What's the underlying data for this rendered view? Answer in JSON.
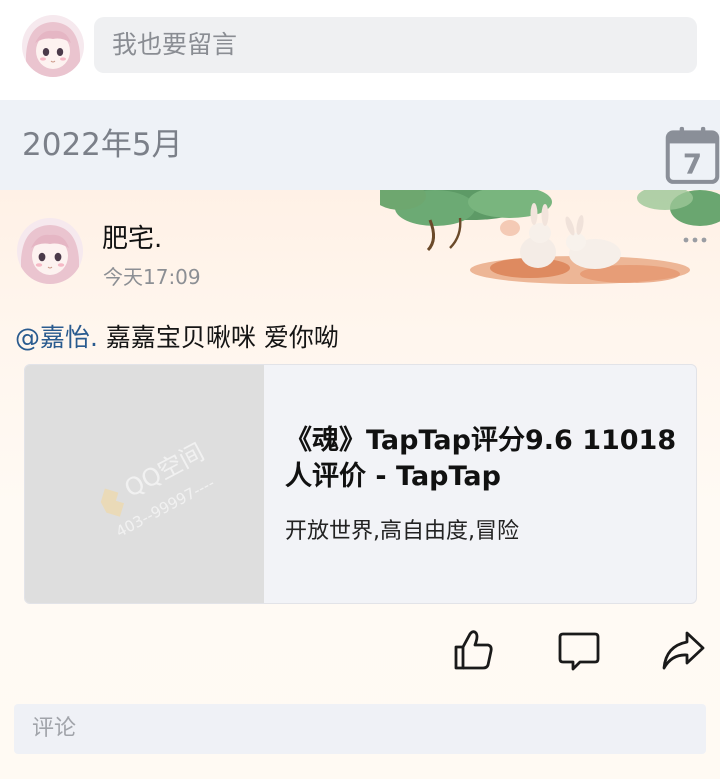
{
  "composer": {
    "placeholder": "我也要留言"
  },
  "month_header": {
    "label": "2022年5月",
    "calendar_day": "7"
  },
  "post": {
    "author": "肥宅.",
    "time": "今天17:09",
    "mention": "@嘉怡.",
    "text": " 嘉嘉宝贝啾咪 爱你呦",
    "link": {
      "watermark_brand": "QQ空间",
      "watermark_id": "403--99997----",
      "title": "《魂》TapTap评分9.6 11018人评价 - TapTap",
      "description": "开放世界,高自由度,冒险"
    },
    "comment_placeholder": "评论"
  },
  "icons": {
    "calendar": "calendar-icon",
    "more": "more-dots-icon",
    "like": "thumbs-up-icon",
    "comment": "comment-bubble-icon",
    "share": "share-arrow-icon"
  },
  "colors": {
    "mention": "#2a5b8f",
    "page_bg": "#ffffff",
    "month_bar_bg": "#eef2f7",
    "post_bg": "#fff6ee"
  }
}
